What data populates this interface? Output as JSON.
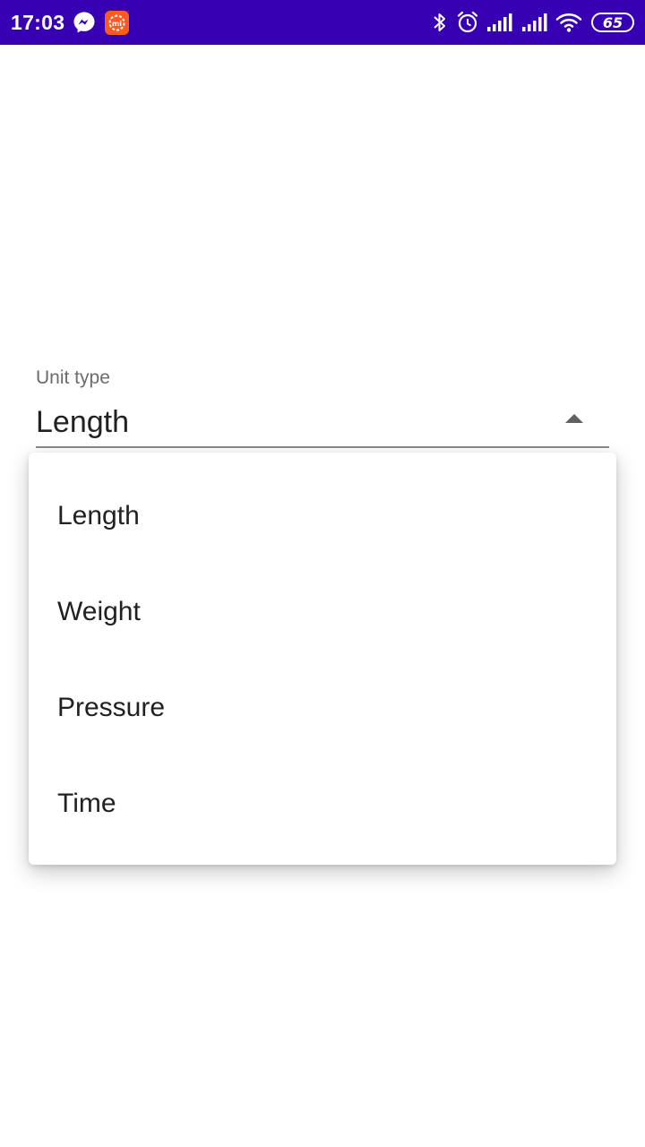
{
  "status_bar": {
    "time": "17:03",
    "battery": "65",
    "icons": [
      "messenger-icon",
      "mi-app-icon",
      "bluetooth-icon",
      "alarm-icon",
      "signal-icon",
      "signal-icon",
      "wifi-icon",
      "battery-icon"
    ],
    "background": "#3700b3"
  },
  "unit_field": {
    "label": "Unit type",
    "value": "Length",
    "arrow_icon": "arrow-up-icon"
  },
  "dropdown": {
    "options": [
      {
        "label": "Length"
      },
      {
        "label": "Weight"
      },
      {
        "label": "Pressure"
      },
      {
        "label": "Time"
      }
    ]
  }
}
